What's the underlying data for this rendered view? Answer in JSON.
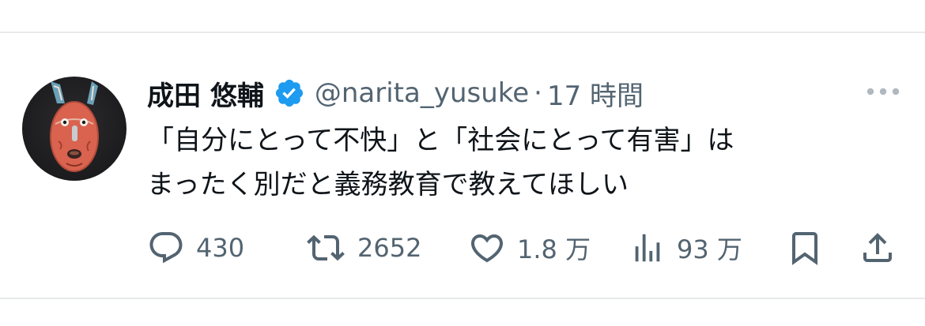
{
  "tweet": {
    "author": {
      "display_name": "成田 悠輔",
      "handle": "@narita_yusuke",
      "verified": true
    },
    "separator": "·",
    "time": "17 時間",
    "text": "「自分にとって不快」と「社会にとって有害」は\nまったく別だと義務教育で教えてほしい"
  },
  "actions": {
    "reply": {
      "icon": "reply-icon",
      "count": "430"
    },
    "retweet": {
      "icon": "retweet-icon",
      "count": "2652"
    },
    "like": {
      "icon": "heart-icon",
      "count": "1.8 万"
    },
    "views": {
      "icon": "analytics-icon",
      "count": "93 万"
    },
    "bookmark": {
      "icon": "bookmark-icon"
    },
    "share": {
      "icon": "share-icon"
    }
  },
  "colors": {
    "verified_badge": "#1d9bf0",
    "secondary_text": "#536471",
    "primary_text": "#0f1419",
    "divider": "#e7e9ea"
  }
}
